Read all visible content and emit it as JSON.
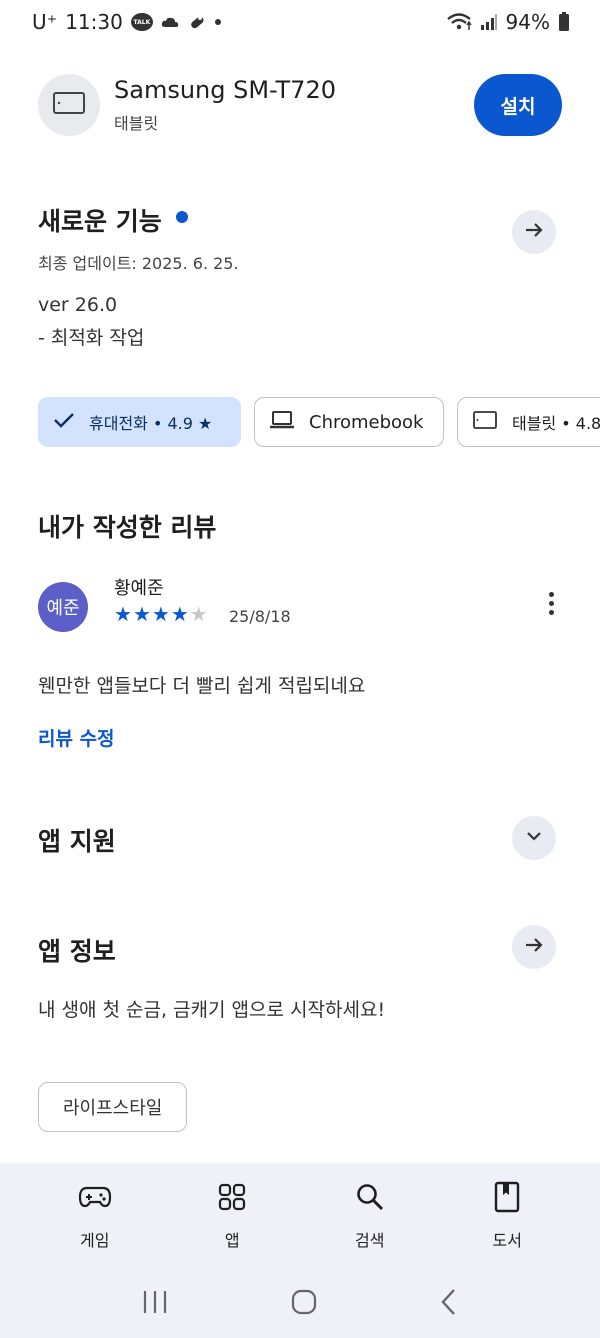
{
  "status_bar": {
    "carrier": "U⁺",
    "time": "11:30",
    "talk_badge": "TALK",
    "battery": "94%"
  },
  "device": {
    "name": "Samsung SM-T720",
    "type": "태블릿",
    "install_label": "설치"
  },
  "whats_new": {
    "title": "새로운 기능",
    "updated": "최종 업데이트: 2025. 6. 25.",
    "version": "ver 26.0",
    "note": "- 최적화 작업"
  },
  "device_chips": [
    {
      "label": "휴대전화 • 4.9 ★",
      "selected": true
    },
    {
      "label": "Chromebook",
      "selected": false
    },
    {
      "label": "태블릿 • 4.8",
      "selected": false
    }
  ],
  "my_review": {
    "title": "내가 작성한 리뷰",
    "avatar_text": "예준",
    "reviewer": "황예준",
    "rating": 4,
    "date": "25/8/18",
    "text": "웬만한 앱들보다 더 빨리 쉽게 적립되네요",
    "edit_label": "리뷰 수정"
  },
  "app_support": {
    "title": "앱 지원"
  },
  "app_info": {
    "title": "앱 정보",
    "description": "내 생애 첫 순금, 금캐기 앱으로 시작하세요!",
    "category": "라이프스타일"
  },
  "bottom_nav": [
    {
      "label": "게임",
      "icon": "gamepad-icon"
    },
    {
      "label": "앱",
      "icon": "apps-grid-icon"
    },
    {
      "label": "검색",
      "icon": "search-icon"
    },
    {
      "label": "도서",
      "icon": "book-icon"
    }
  ],
  "colors": {
    "accent": "#0b57d0",
    "chip_selected": "#d3e3fd",
    "nav_bg": "#eef1f8",
    "avatar": "#5b5fc7"
  }
}
